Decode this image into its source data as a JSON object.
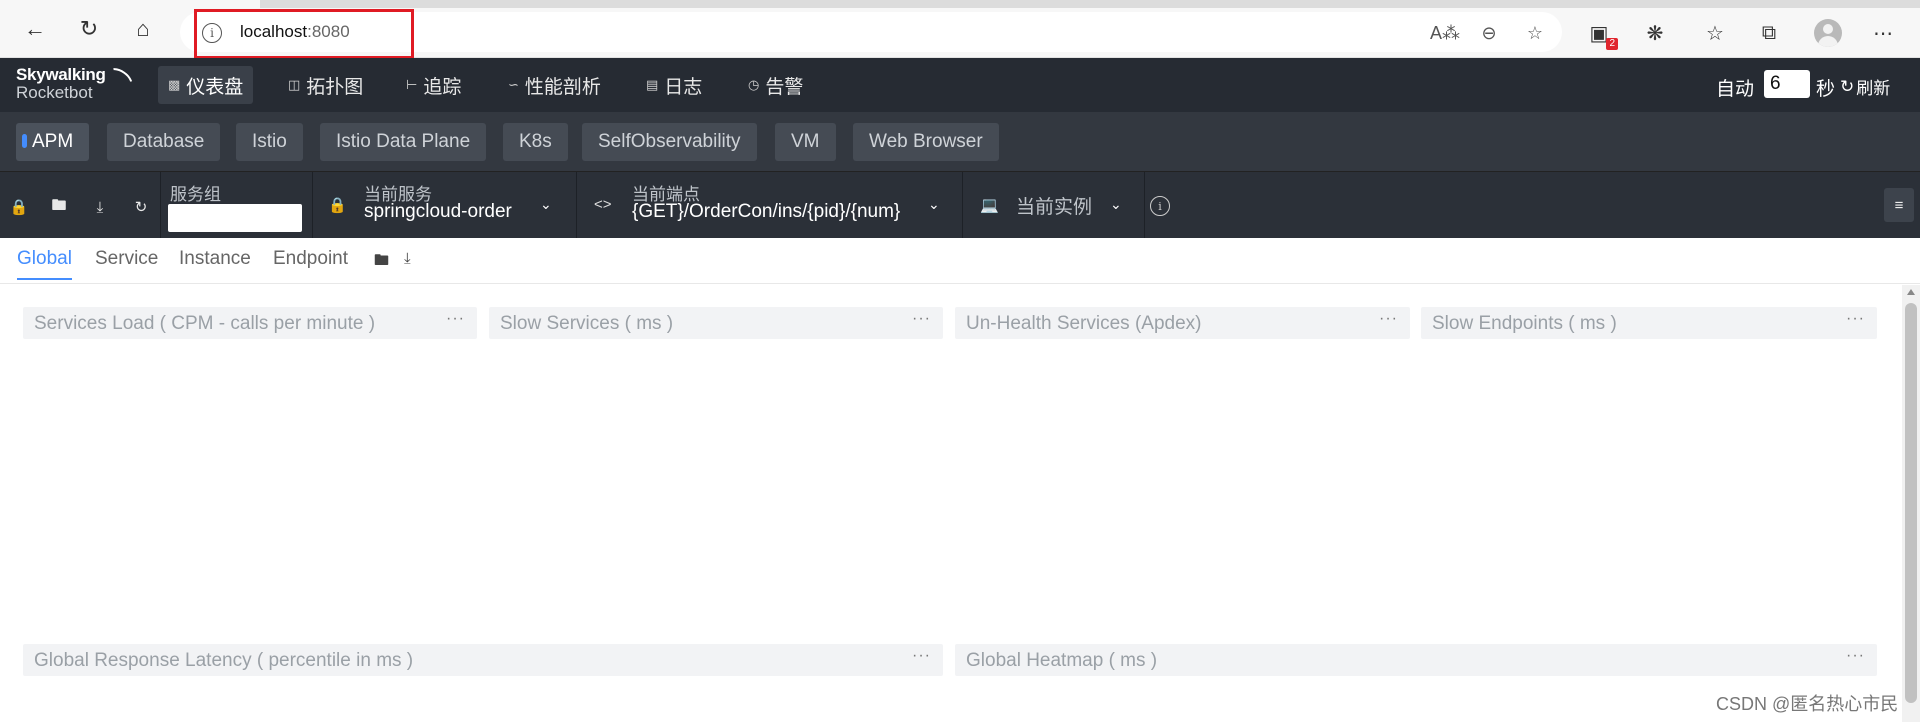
{
  "browser": {
    "url_host": "localhost",
    "url_port": ":8080",
    "extension_badge": "2"
  },
  "brand": {
    "line1": "Skywalking",
    "line2": "Rocketbot"
  },
  "nav": {
    "items": [
      {
        "label": "仪表盘",
        "icon": "dashboard-icon",
        "active": true
      },
      {
        "label": "拓扑图",
        "icon": "topology-icon",
        "active": false
      },
      {
        "label": "追踪",
        "icon": "trace-icon",
        "active": false
      },
      {
        "label": "性能剖析",
        "icon": "profile-icon",
        "active": false
      },
      {
        "label": "日志",
        "icon": "log-icon",
        "active": false
      },
      {
        "label": "告警",
        "icon": "alarm-icon",
        "active": false
      }
    ],
    "auto_label": "自动",
    "auto_value": "6",
    "seconds_label": "秒",
    "refresh_label": "刷新"
  },
  "layers": [
    "APM",
    "Database",
    "Istio",
    "Istio Data Plane",
    "K8s",
    "SelfObservability",
    "VM",
    "Web Browser"
  ],
  "selectors": {
    "group_label": "服务组",
    "group_value": "",
    "service_label": "当前服务",
    "service_value": "springcloud-order",
    "endpoint_label": "当前端点",
    "endpoint_value": "{GET}/OrderCon/ins/{pid}/{num}",
    "instance_label": "当前实例"
  },
  "dashboard_tabs": [
    "Global",
    "Service",
    "Instance",
    "Endpoint"
  ],
  "widgets": [
    {
      "title": "Services Load ( CPM - calls per minute )"
    },
    {
      "title": "Slow Services ( ms )"
    },
    {
      "title": "Un-Health Services (Apdex)"
    },
    {
      "title": "Slow Endpoints ( ms )"
    },
    {
      "title": "Global Response Latency ( percentile in ms )"
    },
    {
      "title": "Global Heatmap ( ms )"
    }
  ],
  "widget_menu": "···",
  "watermark": "CSDN @匿名热心市民"
}
